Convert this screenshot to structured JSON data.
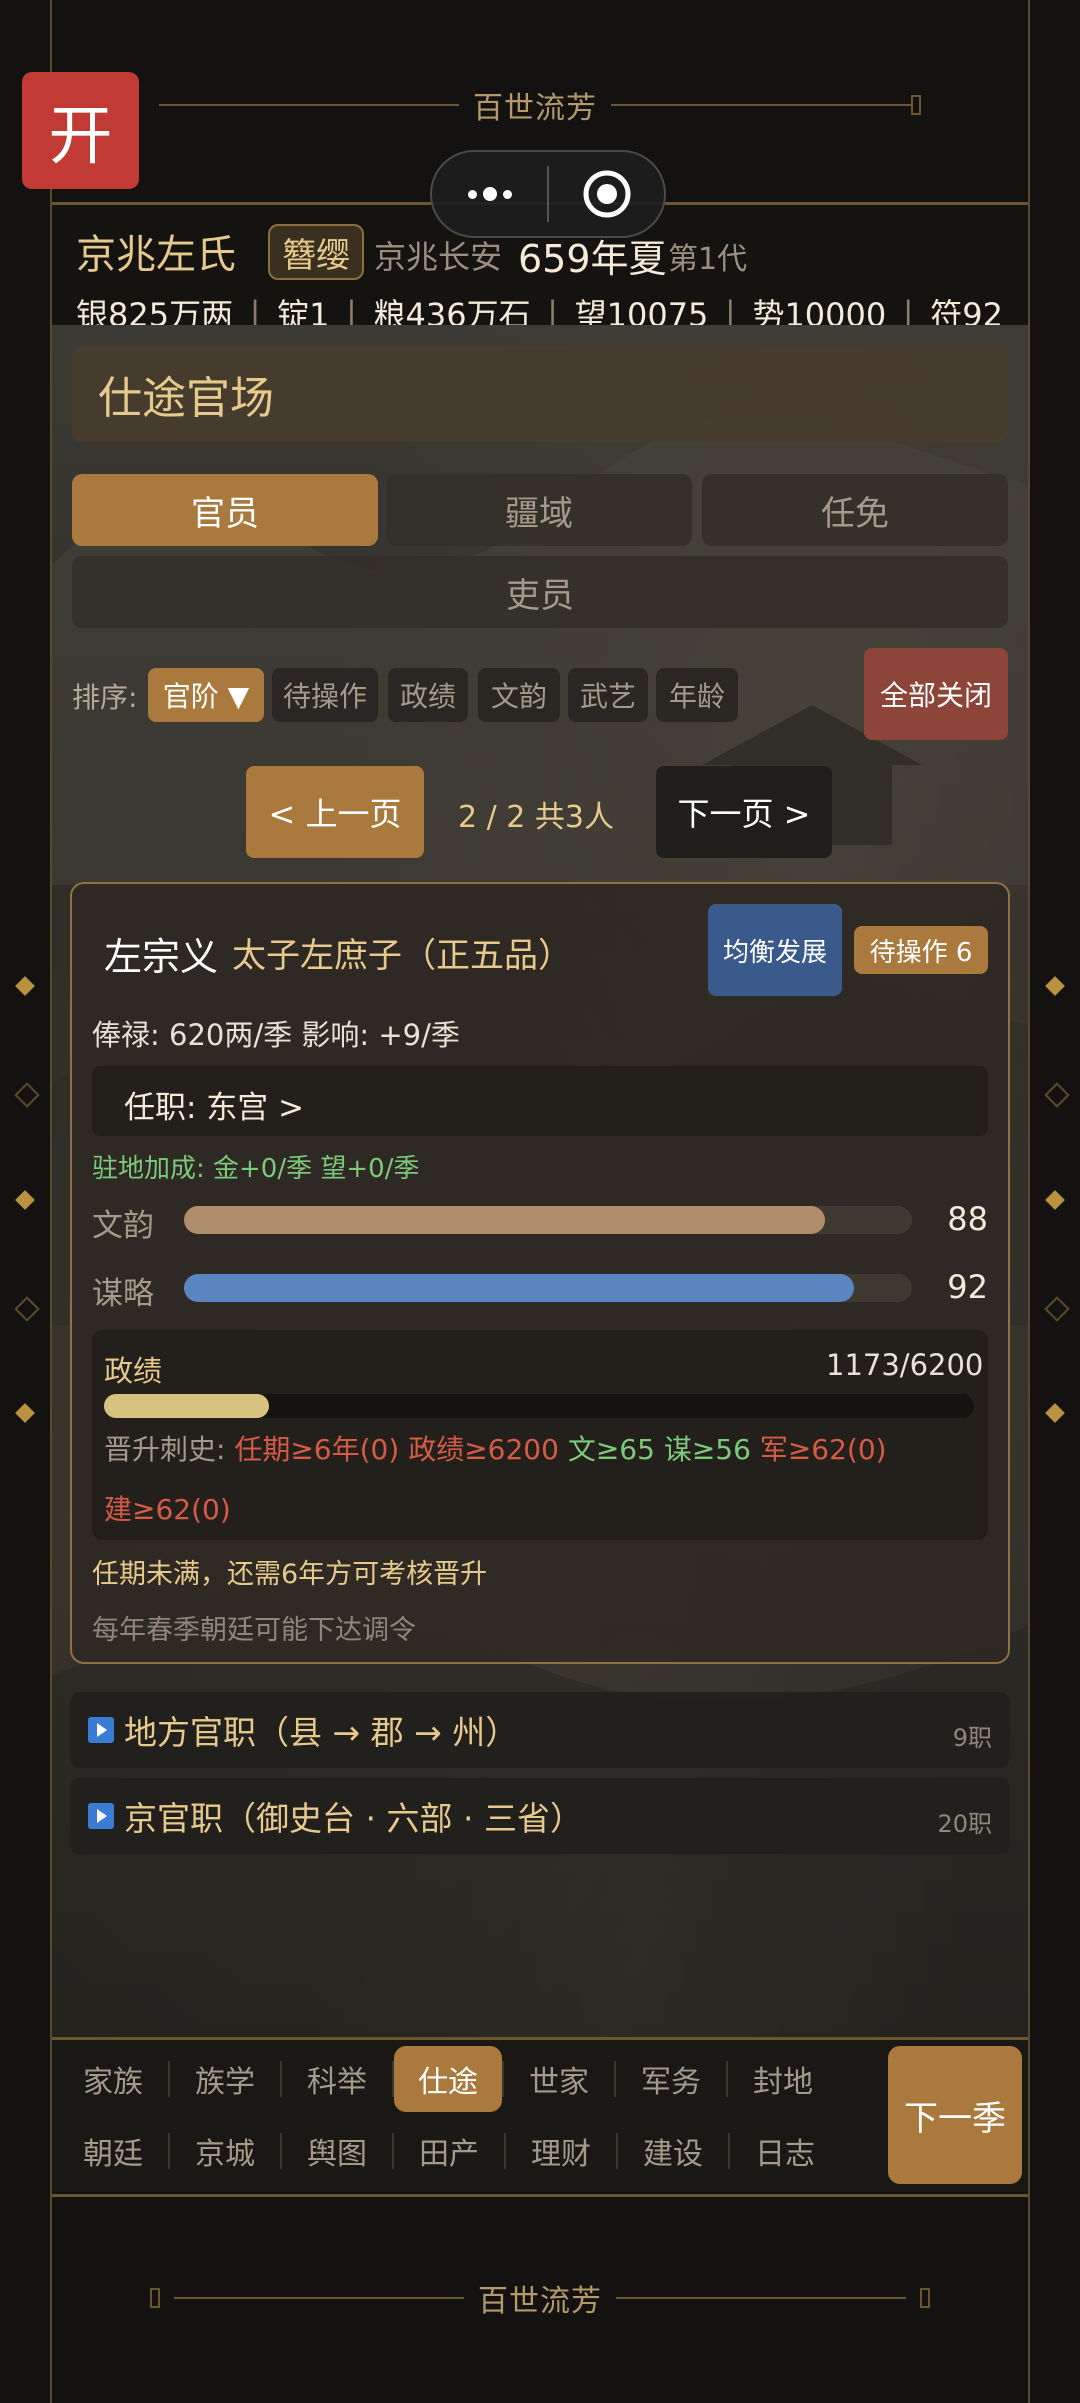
{
  "app_title": "百世流芳",
  "footer_title": "百世流芳",
  "kai_label": "开",
  "header": {
    "family_name": "京兆左氏",
    "rank_badge": "簪缨",
    "location": "京兆长安",
    "date": "659年夏",
    "generation": "第1代",
    "resources": [
      "银825万两",
      "锭1",
      "粮436万石",
      "望10075",
      "势10000",
      "符92"
    ],
    "resource_divider": "丨"
  },
  "section": {
    "title": "仕途官场"
  },
  "tabs": [
    {
      "label": "官员",
      "active": true
    },
    {
      "label": "疆域",
      "active": false
    },
    {
      "label": "任免",
      "active": false
    },
    {
      "label": "吏员",
      "active": false
    }
  ],
  "sort": {
    "label": "排序:",
    "options": [
      {
        "label": "官阶 ▼",
        "active": true
      },
      {
        "label": "待操作",
        "active": false
      },
      {
        "label": "政绩",
        "active": false
      },
      {
        "label": "文韵",
        "active": false
      },
      {
        "label": "武艺",
        "active": false
      },
      {
        "label": "年龄",
        "active": false
      }
    ],
    "close_all": "全部关闭"
  },
  "pager": {
    "prev": "< 上一页",
    "info": "2 / 2  共3人",
    "next": "下一页 >"
  },
  "official": {
    "name": "左宗义",
    "title": "太子左庶子（正五品）",
    "balance_button": "均衡发展",
    "pending_badge": "待操作 6",
    "salary_line": "俸禄: 620两/季   影响: +9/季",
    "post": "任职: 东宫   >",
    "post_bonus": "驻地加成: 金+0/季  望+0/季",
    "stats": [
      {
        "label": "文韵",
        "value": 88,
        "max": 100,
        "color": "#b08d6a"
      },
      {
        "label": "谋略",
        "value": 92,
        "max": 100,
        "color": "#5a86c0"
      }
    ],
    "merit": {
      "label": "政绩",
      "display": "1173/6200",
      "current": 1173,
      "target": 6200,
      "color": "#d8c27f"
    },
    "promotion": {
      "prefix": "晋升刺史:",
      "requirements": [
        {
          "text": "任期≥6年(0)",
          "met": false
        },
        {
          "text": "政绩≥6200",
          "met": false
        },
        {
          "text": "文≥65",
          "met": true
        },
        {
          "text": "谋≥56",
          "met": true
        },
        {
          "text": "军≥62(0)",
          "met": false
        },
        {
          "text": "建≥62(0)",
          "met": false
        }
      ]
    },
    "note_tenure": "任期未满，还需6年方可考核晋升",
    "note_court": "每年春季朝廷可能下达调令"
  },
  "folds": [
    {
      "title": "地方官职（县 → 郡 → 州）",
      "count": "9职"
    },
    {
      "title": "京官职（御史台 · 六部 · 三省）",
      "count": "20职"
    }
  ],
  "bottom_nav": {
    "row1": [
      "家族",
      "族学",
      "科举",
      "仕途",
      "世家",
      "军务",
      "封地"
    ],
    "row2": [
      "朝廷",
      "京城",
      "舆图",
      "田产",
      "理财",
      "建设",
      "日志"
    ],
    "active": "仕途",
    "next_season": "下一季"
  },
  "colors": {
    "accent": "#a9793d",
    "gold_text": "#e6c98d",
    "danger": "#c23a34",
    "blue_button": "#3a5a8c",
    "green": "#7cc97c",
    "red": "#d65a48"
  }
}
